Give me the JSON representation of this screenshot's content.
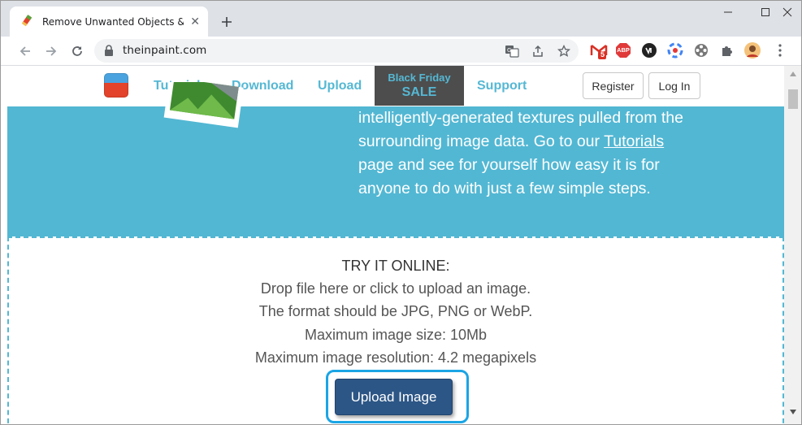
{
  "browser": {
    "tab_title": "Remove Unwanted Objects & Fix",
    "tab_close": "✕",
    "new_tab": "+",
    "url": "theinpaint.com"
  },
  "extensions": {
    "gmail_badge": "5",
    "abp_label": "ABP"
  },
  "site_nav": {
    "links": [
      "Tutorials",
      "Download",
      "Upload"
    ],
    "black_friday_line1": "Black Friday",
    "black_friday_line2": "SALE",
    "support": "Support",
    "register": "Register",
    "login": "Log In"
  },
  "hero": {
    "text_before": "intelligently-generated textures pulled from the surrounding image data. Go to our ",
    "link": "Tutorials",
    "text_after": " page and see for yourself how easy it is for anyone to do with just a few simple steps."
  },
  "dropzone": {
    "title": "TRY IT ONLINE:",
    "lines": [
      "Drop file here or click to upload an image.",
      "The format should be JPG, PNG or WebP.",
      "Maximum image size: 10Mb",
      "Maximum image resolution: 4.2 megapixels"
    ],
    "upload_button": "Upload Image"
  },
  "colors": {
    "accent": "#52b7d3",
    "upload_button": "#2c5686",
    "highlight": "#1aa5e5"
  }
}
